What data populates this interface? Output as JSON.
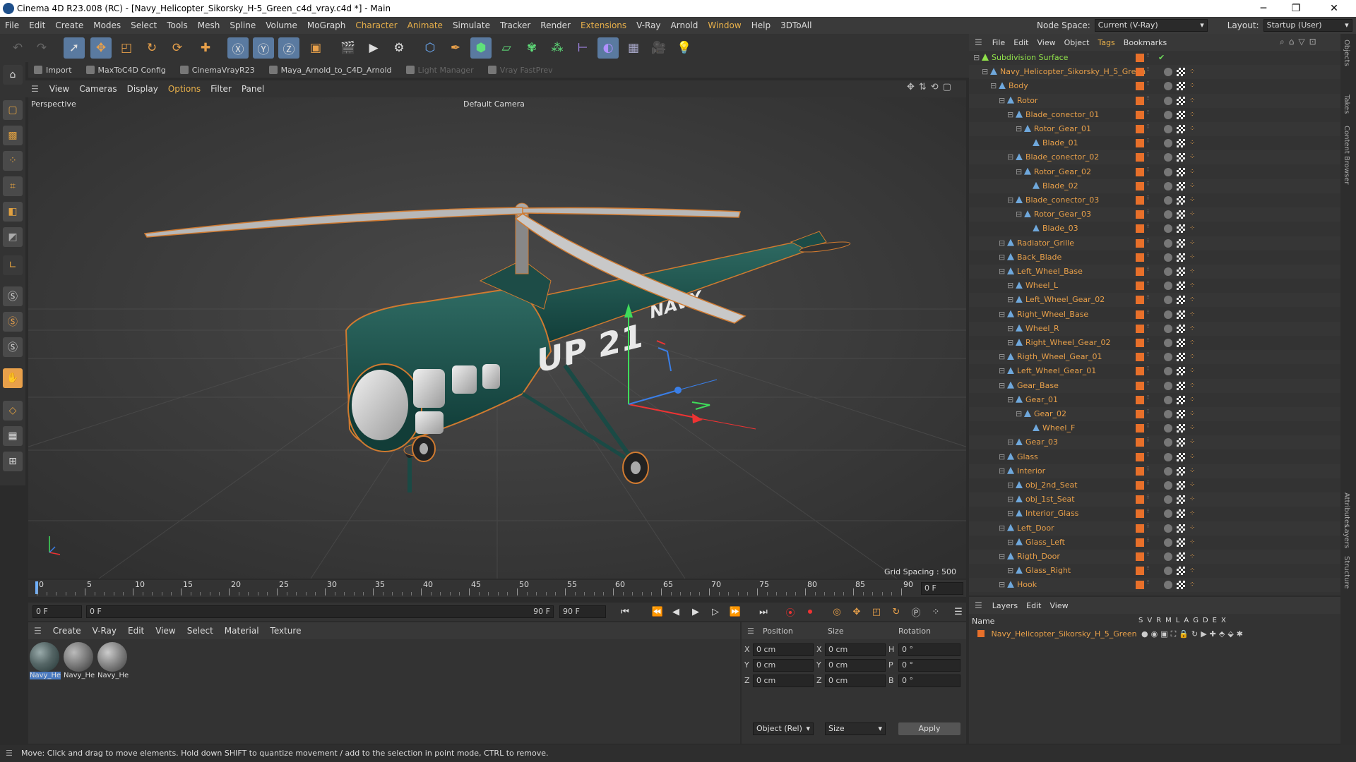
{
  "window": {
    "title": "Cinema 4D R23.008 (RC) - [Navy_Helicopter_Sikorsky_H-5_Green_c4d_vray.c4d *] - Main",
    "minimize": "─",
    "maximize": "❐",
    "close": "✕"
  },
  "menubar": {
    "items": [
      "File",
      "Edit",
      "Create",
      "Modes",
      "Select",
      "Tools",
      "Mesh",
      "Spline",
      "Volume",
      "MoGraph",
      "Character",
      "Animate",
      "Simulate",
      "Tracker",
      "Render",
      "Extensions",
      "V-Ray",
      "Arnold",
      "Window",
      "Help",
      "3DToAll"
    ],
    "node_space_label": "Node Space:",
    "node_space_value": "Current (V-Ray)",
    "layout_label": "Layout:",
    "layout_value": "Startup (User)"
  },
  "plugins": [
    "Import",
    "MaxToC4D Config",
    "CinemaVrayR23",
    "Maya_Arnold_to_C4D_Arnold",
    "Light Manager",
    "Vray FastPrev"
  ],
  "viewport_menu": [
    "View",
    "Cameras",
    "Display",
    "Options",
    "Filter",
    "Panel"
  ],
  "viewport": {
    "name": "Perspective",
    "camera": "Default Camera",
    "grid_spacing": "Grid Spacing : 500 cm",
    "fuselage_marking": "UP 21",
    "tail_marking": "NAVY"
  },
  "timeline": {
    "ticks": [
      "0",
      "5",
      "10",
      "15",
      "20",
      "25",
      "30",
      "35",
      "40",
      "45",
      "50",
      "55",
      "60",
      "65",
      "70",
      "75",
      "80",
      "85",
      "90"
    ],
    "end_field": "0 F"
  },
  "playback": {
    "current": "0 F",
    "start": "0 F",
    "range_end": "90 F",
    "end": "90 F"
  },
  "material_menu": [
    "Create",
    "V-Ray",
    "Edit",
    "View",
    "Select",
    "Material",
    "Texture"
  ],
  "materials": [
    "Navy_He",
    "Navy_He",
    "Navy_He"
  ],
  "coords": {
    "headers": [
      "Position",
      "Size",
      "Rotation"
    ],
    "rows": [
      {
        "axis": "X",
        "pos": "0 cm",
        "saxis": "X",
        "size": "0 cm",
        "raxis": "H",
        "rot": "0 °"
      },
      {
        "axis": "Y",
        "pos": "0 cm",
        "saxis": "Y",
        "size": "0 cm",
        "raxis": "P",
        "rot": "0 °"
      },
      {
        "axis": "Z",
        "pos": "0 cm",
        "saxis": "Z",
        "size": "0 cm",
        "raxis": "B",
        "rot": "0 °"
      }
    ],
    "mode": "Object (Rel)",
    "size_mode": "Size",
    "apply": "Apply"
  },
  "objects_menu": [
    "File",
    "Edit",
    "View",
    "Object",
    "Tags",
    "Bookmarks"
  ],
  "objects": [
    {
      "label": "Subdivision Surface",
      "depth": 0,
      "color": "#8fe04a"
    },
    {
      "label": "Navy_Helicopter_Sikorsky_H_5_Green",
      "depth": 1
    },
    {
      "label": "Body",
      "depth": 2
    },
    {
      "label": "Rotor",
      "depth": 3
    },
    {
      "label": "Blade_conector_01",
      "depth": 4
    },
    {
      "label": "Rotor_Gear_01",
      "depth": 5
    },
    {
      "label": "Blade_01",
      "depth": 6
    },
    {
      "label": "Blade_conector_02",
      "depth": 4
    },
    {
      "label": "Rotor_Gear_02",
      "depth": 5
    },
    {
      "label": "Blade_02",
      "depth": 6
    },
    {
      "label": "Blade_conector_03",
      "depth": 4
    },
    {
      "label": "Rotor_Gear_03",
      "depth": 5
    },
    {
      "label": "Blade_03",
      "depth": 6
    },
    {
      "label": "Radiator_Grille",
      "depth": 3
    },
    {
      "label": "Back_Blade",
      "depth": 3
    },
    {
      "label": "Left_Wheel_Base",
      "depth": 3
    },
    {
      "label": "Wheel_L",
      "depth": 4
    },
    {
      "label": "Left_Wheel_Gear_02",
      "depth": 4
    },
    {
      "label": "Right_Wheel_Base",
      "depth": 3
    },
    {
      "label": "Wheel_R",
      "depth": 4
    },
    {
      "label": "Right_Wheel_Gear_02",
      "depth": 4
    },
    {
      "label": "Rigth_Wheel_Gear_01",
      "depth": 3
    },
    {
      "label": "Left_Wheel_Gear_01",
      "depth": 3
    },
    {
      "label": "Gear_Base",
      "depth": 3
    },
    {
      "label": "Gear_01",
      "depth": 4
    },
    {
      "label": "Gear_02",
      "depth": 5
    },
    {
      "label": "Wheel_F",
      "depth": 6
    },
    {
      "label": "Gear_03",
      "depth": 4
    },
    {
      "label": "Glass",
      "depth": 3
    },
    {
      "label": "Interior",
      "depth": 3
    },
    {
      "label": "obj_2nd_Seat",
      "depth": 4
    },
    {
      "label": "obj_1st_Seat",
      "depth": 4
    },
    {
      "label": "Interior_Glass",
      "depth": 4
    },
    {
      "label": "Left_Door",
      "depth": 3
    },
    {
      "label": "Glass_Left",
      "depth": 4
    },
    {
      "label": "Rigth_Door",
      "depth": 3
    },
    {
      "label": "Glass_Right",
      "depth": 4
    },
    {
      "label": "Hook",
      "depth": 3
    }
  ],
  "layers_menu": [
    "Layers",
    "Edit",
    "View"
  ],
  "layers": {
    "name_header": "Name",
    "flags": [
      "S",
      "V",
      "R",
      "M",
      "L",
      "A",
      "G",
      "D",
      "E",
      "X"
    ],
    "rows": [
      "Navy_Helicopter_Sikorsky_H_5_Green"
    ]
  },
  "side_tabs": [
    "Objects",
    "Takes",
    "Content Browser",
    "Attributes",
    "Layers",
    "Structure"
  ],
  "status": "Move: Click and drag to move elements. Hold down SHIFT to quantize movement / add to the selection in point mode, CTRL to remove."
}
